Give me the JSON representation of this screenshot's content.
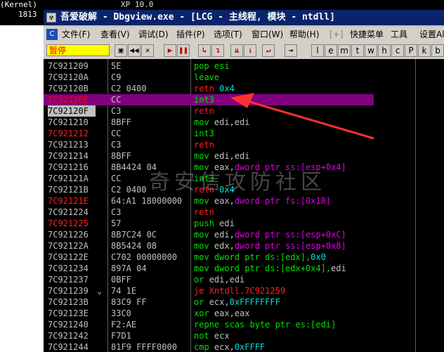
{
  "outer": {
    "left_title": "(Kernel)",
    "left_text": "1813",
    "top_text": "XP 10.0"
  },
  "window": {
    "title": "吾爱破解 - Dbgview.exe - [LCG - 主线程, 模块 - ntdll]"
  },
  "menu": {
    "items": [
      "文件(F)",
      "查看(V)",
      "调试(D)",
      "插件(P)",
      "选项(T)",
      "窗口(W)",
      "帮助(H)",
      "[+]",
      "快捷菜单",
      "工具",
      "设置Al"
    ]
  },
  "toolbar": {
    "status": "暂停",
    "letters": [
      "l",
      "e",
      "m",
      "t",
      "w",
      "h",
      "c",
      "P",
      "k",
      "b",
      "r"
    ]
  },
  "disasm": {
    "rows": [
      {
        "addr": "7C921209",
        "hex": "5E",
        "parts": [
          [
            "pop esi",
            "g"
          ]
        ]
      },
      {
        "addr": "7C92120A",
        "hex": "C9",
        "parts": [
          [
            "leave",
            "g"
          ]
        ]
      },
      {
        "addr": "7C92120B",
        "hex": "C2 0400",
        "parts": [
          [
            "retn ",
            "r"
          ],
          [
            "0x4",
            "c"
          ]
        ]
      },
      {
        "addr": "7C92120E",
        "hex": "CC",
        "parts": [
          [
            "int3",
            "g"
          ]
        ],
        "selected": true
      },
      {
        "addr": "7C92120F",
        "hex": "C3",
        "parts": [
          [
            "retn",
            "r"
          ]
        ],
        "addr_hl": true
      },
      {
        "addr": "7C921210",
        "hex": "8BFF",
        "parts": [
          [
            "mov ",
            "g"
          ],
          [
            "edi,edi",
            "p"
          ]
        ]
      },
      {
        "addr": "7C921212",
        "hex": "CC",
        "parts": [
          [
            "int3",
            "g"
          ]
        ],
        "addr_red": true
      },
      {
        "addr": "7C921213",
        "hex": "C3",
        "parts": [
          [
            "retn",
            "r"
          ]
        ]
      },
      {
        "addr": "7C921214",
        "hex": "8BFF",
        "parts": [
          [
            "mov ",
            "g"
          ],
          [
            "edi,edi",
            "p"
          ]
        ]
      },
      {
        "addr": "7C921216",
        "hex": "8B4424 04",
        "parts": [
          [
            "mov ",
            "g"
          ],
          [
            "eax,",
            "p"
          ],
          [
            "dword ptr ss:[esp+0x4]",
            "m"
          ]
        ]
      },
      {
        "addr": "7C92121A",
        "hex": "CC",
        "parts": [
          [
            "int3",
            "g"
          ]
        ]
      },
      {
        "addr": "7C92121B",
        "hex": "C2 0400",
        "parts": [
          [
            "retn ",
            "r"
          ],
          [
            "0x4",
            "c"
          ]
        ]
      },
      {
        "addr": "7C92121E",
        "hex": "64:A1 18000000",
        "parts": [
          [
            "mov ",
            "g"
          ],
          [
            "eax,",
            "p"
          ],
          [
            "dword ptr fs:[0x18]",
            "m"
          ]
        ],
        "addr_red": true
      },
      {
        "addr": "7C921224",
        "hex": "C3",
        "parts": [
          [
            "retn",
            "r"
          ]
        ]
      },
      {
        "addr": "7C921225",
        "hex": "57",
        "parts": [
          [
            "push ",
            "g"
          ],
          [
            "edi",
            "p"
          ]
        ],
        "addr_red": true
      },
      {
        "addr": "7C921226",
        "hex": "8B7C24 0C",
        "parts": [
          [
            "mov ",
            "g"
          ],
          [
            "edi,",
            "p"
          ],
          [
            "dword ptr ss:[esp+0xC]",
            "m"
          ]
        ]
      },
      {
        "addr": "7C92122A",
        "hex": "8B5424 08",
        "parts": [
          [
            "mov ",
            "g"
          ],
          [
            "edx,",
            "p"
          ],
          [
            "dword ptr ss:[esp+0x8]",
            "m"
          ]
        ]
      },
      {
        "addr": "7C92122E",
        "hex": "C702 00000000",
        "parts": [
          [
            "mov dword ptr ds:[edx],",
            "g"
          ],
          [
            "0x0",
            "c"
          ]
        ]
      },
      {
        "addr": "7C921234",
        "hex": "897A 04",
        "parts": [
          [
            "mov dword ptr ds:[edx+0x4],",
            "g"
          ],
          [
            "edi",
            "p"
          ]
        ]
      },
      {
        "addr": "7C921237",
        "hex": "0BFF",
        "parts": [
          [
            "or ",
            "g"
          ],
          [
            "edi,edi",
            "p"
          ]
        ]
      },
      {
        "addr": "7C921239",
        "hex": "74 1E",
        "parts": [
          [
            "je Xntdll.7C921259",
            "r"
          ]
        ],
        "mark": "⌄"
      },
      {
        "addr": "7C92123B",
        "hex": "83C9 FF",
        "parts": [
          [
            "or ",
            "g"
          ],
          [
            "ecx,",
            "p"
          ],
          [
            "0xFFFFFFFF",
            "c"
          ]
        ]
      },
      {
        "addr": "7C92123E",
        "hex": "33C0",
        "parts": [
          [
            "xor ",
            "g"
          ],
          [
            "eax,eax",
            "p"
          ]
        ]
      },
      {
        "addr": "7C921240",
        "hex": "F2:AE",
        "parts": [
          [
            "repne scas byte ptr es:[edi]",
            "g"
          ]
        ]
      },
      {
        "addr": "7C921242",
        "hex": "F7D1",
        "parts": [
          [
            "not ",
            "g"
          ],
          [
            "ecx",
            "p"
          ]
        ]
      },
      {
        "addr": "7C921244",
        "hex": "81F9 FFFF0000",
        "parts": [
          [
            "cmp ",
            "g"
          ],
          [
            "ecx,",
            "p"
          ],
          [
            "0xFFFF",
            "c"
          ]
        ]
      }
    ]
  },
  "watermark": "奇安信攻防社区"
}
